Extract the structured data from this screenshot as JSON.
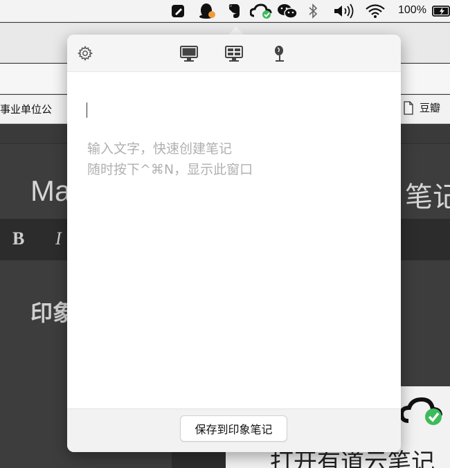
{
  "menubar": {
    "icons": [
      "notes-app-icon",
      "qq-icon",
      "evernote-icon",
      "youdao-cloud-icon",
      "wechat-icon",
      "bluetooth-icon",
      "volume-icon",
      "wifi-icon",
      "battery-icon"
    ],
    "battery_percent": "100%"
  },
  "background": {
    "bookmark_left": "事业单位公",
    "bookmark_right": "豆瓣",
    "title_left": "Ma",
    "title_right": "笔记",
    "toolbar_bold": "B",
    "toolbar_italic": "I",
    "heading": "印象",
    "window_text": "打开有道云笔记"
  },
  "quicknote": {
    "toolbar_icons": [
      "settings-icon",
      "full-screenshot-icon",
      "region-screenshot-icon",
      "audio-note-icon"
    ],
    "placeholder_line1": "输入文字，快速创建笔记",
    "placeholder_line2": "随时按下^⌘N，显示此窗口",
    "save_label": "保存到印象笔记"
  },
  "colors": {
    "popover_bg": "#ffffff",
    "header_bg": "#f5f5f5",
    "placeholder": "#b0b0b0",
    "evernote_green": "#2dbe60",
    "check_green": "#3dbb5a"
  }
}
